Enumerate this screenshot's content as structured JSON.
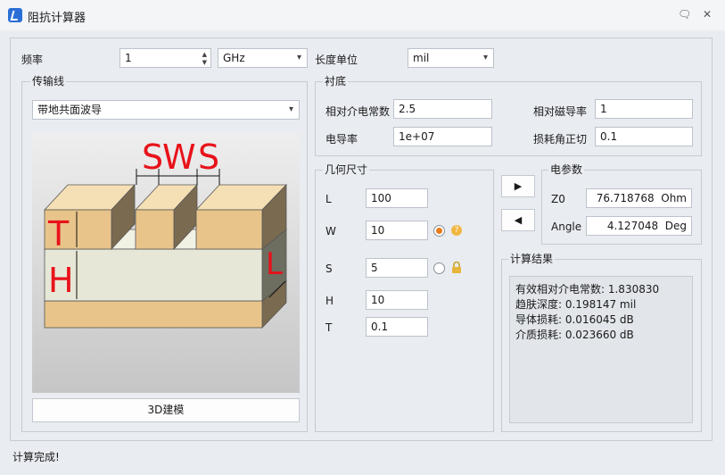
{
  "window": {
    "title": "阻抗计算器",
    "help_glyph": "🗨",
    "close_glyph": "✕"
  },
  "frequency": {
    "label": "频率",
    "value": "1",
    "unit": "GHz"
  },
  "length_unit": {
    "label": "长度单位",
    "value": "mil"
  },
  "transmission_line": {
    "group_title": "传输线",
    "type": "带地共面波导",
    "diagram_labels": {
      "s1": "S",
      "w": "W",
      "s2": "S",
      "t": "T",
      "h": "H",
      "l": "L"
    },
    "model_button": "3D建模"
  },
  "substrate": {
    "group_title": "衬底",
    "dielectric_label": "相对介电常数",
    "dielectric_value": "2.5",
    "permeability_label": "相对磁导率",
    "permeability_value": "1",
    "conductivity_label": "电导率",
    "conductivity_value": "1e+07",
    "loss_tangent_label": "损耗角正切",
    "loss_tangent_value": "0.1"
  },
  "geometry": {
    "group_title": "几何尺寸",
    "l_label": "L",
    "l_value": "100",
    "w_label": "W",
    "w_value": "10",
    "s_label": "S",
    "s_value": "5",
    "h_label": "H",
    "h_value": "10",
    "t_label": "T",
    "t_value": "0.1",
    "help_glyph": "?"
  },
  "actions": {
    "synthesize_glyph": "▶",
    "analyze_glyph": "◀"
  },
  "electrical": {
    "group_title": "电参数",
    "z0_label": "Z0",
    "z0_value": "76.718768",
    "z0_unit": "Ohm",
    "angle_label": "Angle",
    "angle_value": "4.127048",
    "angle_unit": "Deg"
  },
  "results": {
    "group_title": "计算结果",
    "lines": [
      "有效相对介电常数: 1.830830",
      "趋肤深度: 0.198147 mil",
      "导体损耗: 0.016045 dB",
      "介质损耗: 0.023660 dB"
    ]
  },
  "status": "计算完成!",
  "colors": {
    "accent": "#e77b1a",
    "diagram_label": "#e8121a",
    "copper": "#e8c48a",
    "dielectric": "#e7e7d7"
  }
}
